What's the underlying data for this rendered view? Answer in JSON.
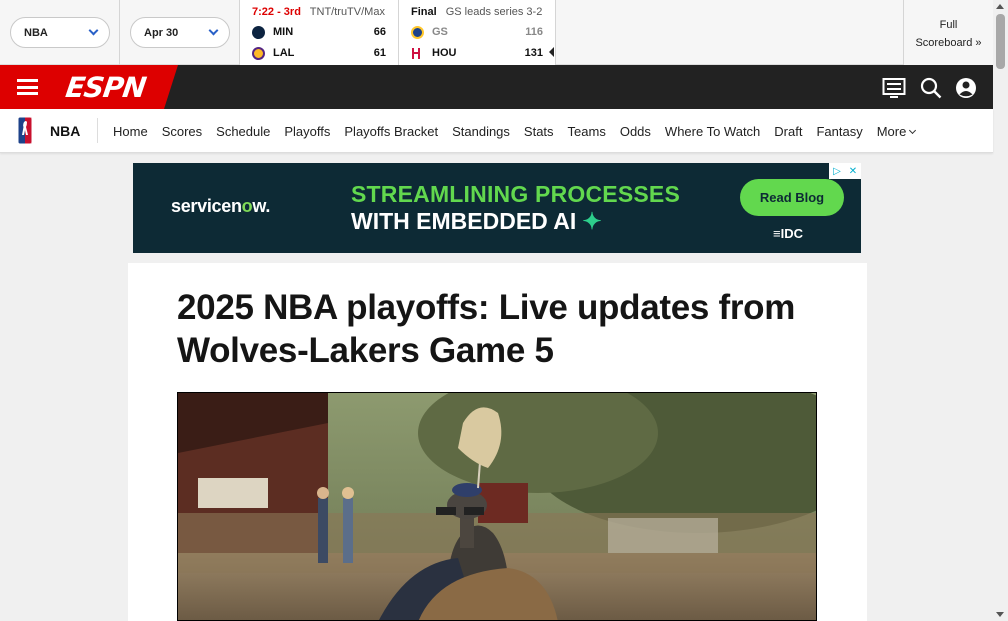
{
  "scoreboard": {
    "league_selector": "NBA",
    "date_selector": "Apr 30",
    "games": [
      {
        "status": "7:22 - 3rd",
        "network": "TNT/truTV/Max",
        "teams": [
          {
            "abbr": "MIN",
            "score": "66",
            "color": "#0c2340"
          },
          {
            "abbr": "LAL",
            "score": "61",
            "color": "#fdb927"
          }
        ]
      },
      {
        "status": "Final",
        "network": "GS leads series 3-2",
        "teams": [
          {
            "abbr": "GS",
            "score": "116",
            "color": "#1d428a"
          },
          {
            "abbr": "HOU",
            "score": "131",
            "color": "#ce1141"
          }
        ]
      }
    ],
    "full_scoreboard_line1": "Full",
    "full_scoreboard_line2": "Scoreboard »"
  },
  "header": {
    "logo_text": "ESPN",
    "brand_red": "#d00",
    "icons": [
      "menu-icon",
      "scores-icon",
      "search-icon",
      "profile-icon"
    ]
  },
  "subnav": {
    "title": "NBA",
    "links": [
      "Home",
      "Scores",
      "Schedule",
      "Playoffs",
      "Playoffs Bracket",
      "Standings",
      "Stats",
      "Teams",
      "Odds",
      "Where To Watch",
      "Draft",
      "Fantasy",
      "More"
    ]
  },
  "ad": {
    "brand_prefix": "servicen",
    "brand_o": "o",
    "brand_suffix": "w.",
    "headline_line1": "STREAMLINING PROCESSES",
    "headline_line2": "WITH EMBEDDED AI",
    "cta": "Read Blog",
    "sponsor": "IDC"
  },
  "article": {
    "headline": "2025 NBA playoffs: Live updates from Wolves-Lakers Game 5"
  }
}
